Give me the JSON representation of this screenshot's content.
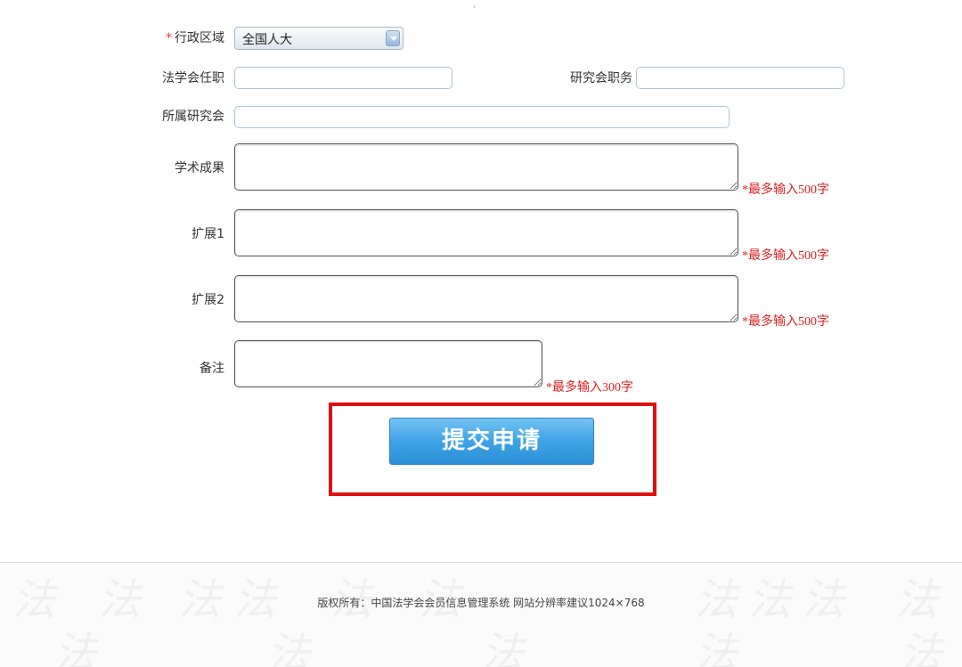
{
  "form": {
    "region": {
      "required_mark": "*",
      "label": "行政区域",
      "value": "全国人大"
    },
    "law_society_position": {
      "label": "法学会任职",
      "value": ""
    },
    "research_position": {
      "label": "研究会职务",
      "value": ""
    },
    "affiliated_society": {
      "label": "所属研究会",
      "value": ""
    },
    "academic_achievements": {
      "label": "学术成果",
      "value": "",
      "hint": "*最多输入500字"
    },
    "extension1": {
      "label": "扩展1",
      "value": "",
      "hint": "*最多输入500字"
    },
    "extension2": {
      "label": "扩展2",
      "value": "",
      "hint": "*最多输入500字"
    },
    "remarks": {
      "label": "备注",
      "value": "",
      "hint": "*最多输入300字"
    },
    "submit_label": "提交申请"
  },
  "footer": {
    "copyright": "版权所有：中国法学会会员信息管理系统 网站分辨率建议1024×768"
  },
  "colors": {
    "required": "#e23b3b",
    "hint": "#e02020",
    "button": "#3fa3e6",
    "highlight": "#e01010"
  },
  "icons": {
    "dropdown": "chevron-down-icon"
  }
}
